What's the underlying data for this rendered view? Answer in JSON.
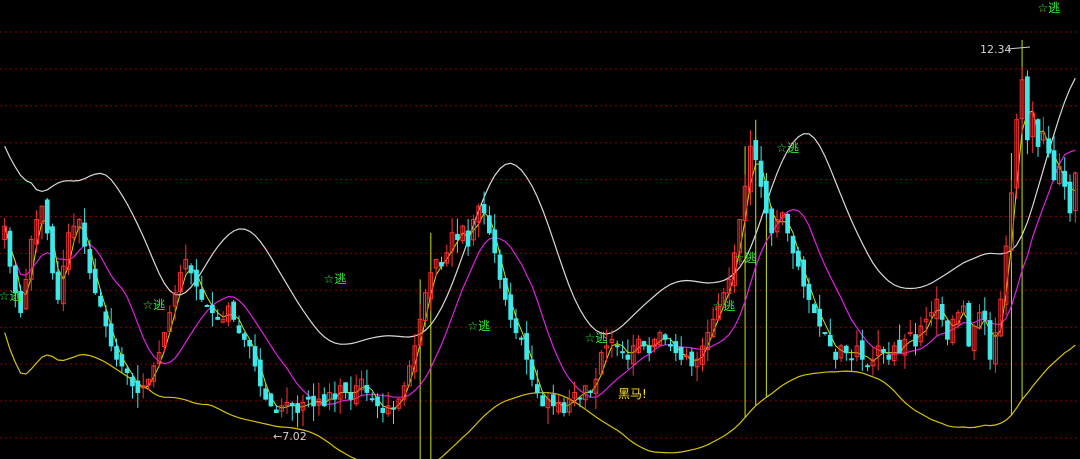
{
  "chart_data": {
    "type": "candlestick",
    "title": "",
    "xlabel": "",
    "ylabel": "",
    "ylim": [
      6.5,
      13.4
    ],
    "grid": true,
    "candle_count": 200,
    "close": [
      10.0,
      9.4,
      9.0,
      8.7,
      9.2,
      9.8,
      10.1,
      10.3,
      9.9,
      9.3,
      8.9,
      9.4,
      9.9,
      10.0,
      10.1,
      9.7,
      9.3,
      9.0,
      8.8,
      8.5,
      8.2,
      8.0,
      7.9,
      7.8,
      7.6,
      7.5,
      7.6,
      7.7,
      7.9,
      8.1,
      8.4,
      8.7,
      9.0,
      9.3,
      9.5,
      9.3,
      9.1,
      8.9,
      8.8,
      8.7,
      8.6,
      8.6,
      8.8,
      8.6,
      8.4,
      8.3,
      8.2,
      7.9,
      7.6,
      7.4,
      7.3,
      7.2,
      7.3,
      7.35,
      7.3,
      7.2,
      7.35,
      7.4,
      7.3,
      7.4,
      7.3,
      7.5,
      7.4,
      7.6,
      7.5,
      7.4,
      7.6,
      7.7,
      7.5,
      7.4,
      7.3,
      7.2,
      7.3,
      7.25,
      7.4,
      7.6,
      7.9,
      8.2,
      8.6,
      9.0,
      9.3,
      9.5,
      9.4,
      9.6,
      9.9,
      9.8,
      10.0,
      9.7,
      10.1,
      10.3,
      10.2,
      9.9,
      9.6,
      9.2,
      8.9,
      8.6,
      8.4,
      8.3,
      8.0,
      7.7,
      7.5,
      7.3,
      7.4,
      7.3,
      7.35,
      7.2,
      7.4,
      7.5,
      7.4,
      7.6,
      7.5,
      7.7,
      8.1,
      8.2,
      8.3,
      8.2,
      8.1,
      8.0,
      8.2,
      8.3,
      8.2,
      8.1,
      8.3,
      8.4,
      8.3,
      8.2,
      8.1,
      8.0,
      8.05,
      7.9,
      8.0,
      8.2,
      8.4,
      8.6,
      8.8,
      9.0,
      9.2,
      9.6,
      10.1,
      10.6,
      11.2,
      11.0,
      10.6,
      10.2,
      9.9,
      10.1,
      10.2,
      9.9,
      9.6,
      9.4,
      9.1,
      8.9,
      8.7,
      8.5,
      8.4,
      8.2,
      8.0,
      8.2,
      8.1,
      8.0,
      8.2,
      8.0,
      7.9,
      8.0,
      8.2,
      8.1,
      8.0,
      8.2,
      8.1,
      8.3,
      8.4,
      8.2,
      8.5,
      8.6,
      8.7,
      8.9,
      8.6,
      8.3,
      8.6,
      8.7,
      8.8,
      8.2,
      8.5,
      8.7,
      8.6,
      8.0,
      8.4,
      8.9,
      9.7,
      10.5,
      11.6,
      12.2,
      11.3,
      11.7,
      11.2,
      11.4,
      11.1,
      10.7,
      10.9,
      10.6,
      10.2,
      10.8
    ]
  },
  "annotations": {
    "escape_label": "☆逃",
    "dark_horse_label": "黑马!",
    "high_label": "12.34",
    "low_label": "←7.02",
    "escape_points": [
      0,
      27,
      61,
      88,
      110,
      134,
      138,
      146,
      195
    ]
  },
  "colors": {
    "up": "#ff3030",
    "down": "#3ee8e8",
    "upper_band": "#d8d8d8",
    "middle_band": "#e020e0",
    "lower_band": "#d4c400",
    "fast_line": "#c8e000",
    "grid": "#8a0000",
    "escape_text": "#33ee33",
    "dark_horse_text": "#ffe020",
    "marker_text": "#d0d0d0"
  }
}
